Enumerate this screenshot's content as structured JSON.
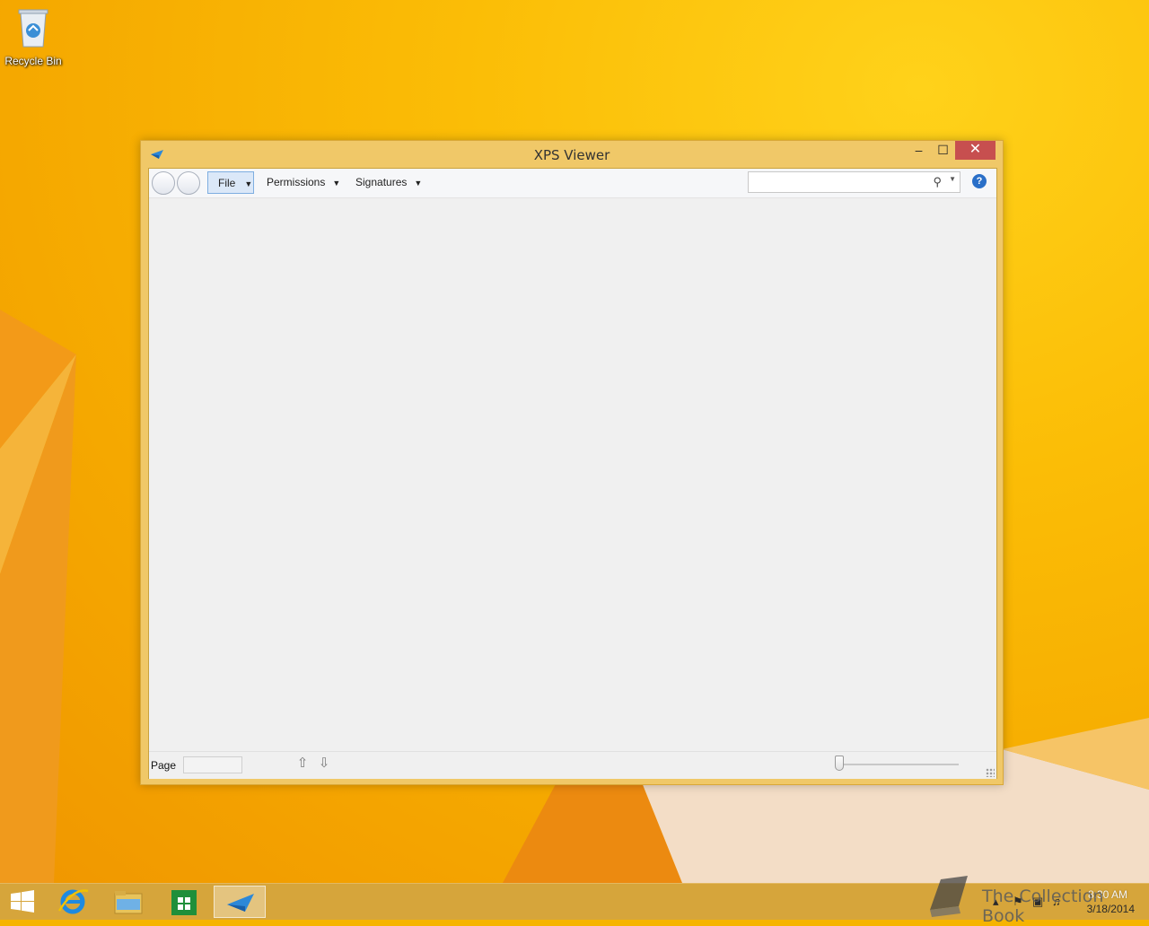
{
  "desktop": {
    "icons": [
      {
        "label": "Recycle Bin"
      }
    ]
  },
  "window": {
    "title": "XPS Viewer",
    "controls": {
      "minimize": "–",
      "maximize": "☐",
      "close": "✕"
    },
    "menus": {
      "file": "File",
      "permissions": "Permissions",
      "signatures": "Signatures"
    },
    "search": {
      "value": "",
      "placeholder": ""
    },
    "status": {
      "page_label": "Page",
      "page_value": ""
    }
  },
  "taskbar": {
    "apps": [
      "start",
      "internet-explorer",
      "file-explorer",
      "store",
      "xps-viewer"
    ],
    "active_app": "xps-viewer",
    "clock": {
      "time": "8:30 AM",
      "date": "3/18/2014"
    }
  },
  "watermark": {
    "text": "The Collection Book"
  },
  "colors": {
    "accent": "#f0c868",
    "close_button": "#c74f4f",
    "taskbar": "#d6a53b",
    "desktop": "#f6b400"
  }
}
